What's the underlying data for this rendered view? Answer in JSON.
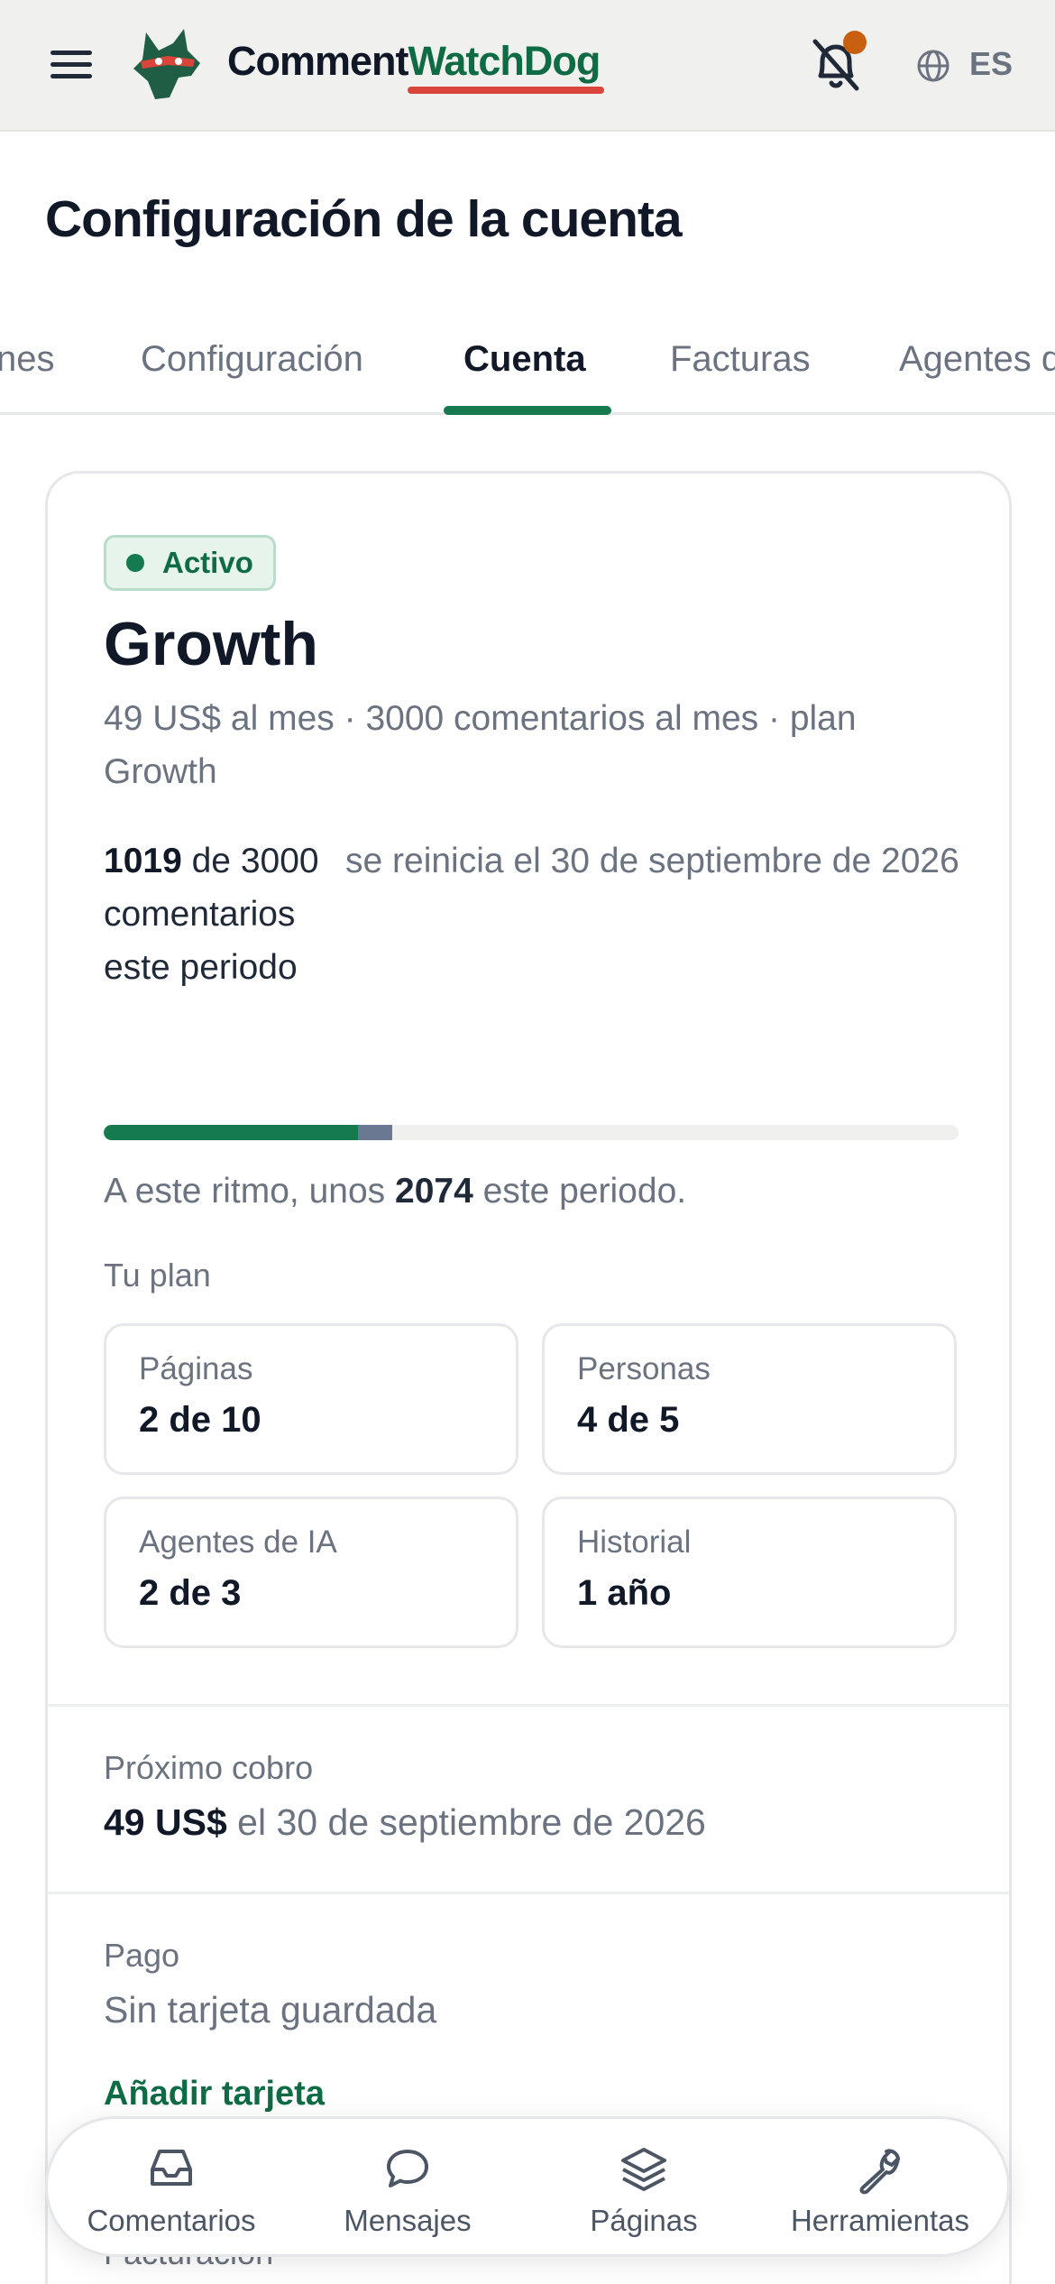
{
  "header": {
    "brand_part1": "Comment",
    "brand_part2": "WatchDog",
    "language": "ES",
    "colors": {
      "brand_green": "#0f6b43",
      "brand_red": "#d9453a",
      "notification_dot": "#c8600f"
    }
  },
  "page": {
    "title": "Configuración de la cuenta"
  },
  "tabs": [
    {
      "label": "nes"
    },
    {
      "label": "Configuración"
    },
    {
      "label": "Cuenta",
      "active": true
    },
    {
      "label": "Facturas"
    },
    {
      "label": "Agentes d"
    }
  ],
  "plan": {
    "status": "Activo",
    "name": "Growth",
    "description": "49 US$ al mes · 3000 comentarios al mes · plan Growth",
    "usage_count": "1019",
    "usage_rest": " de 3000 comentarios este periodo",
    "reset_text": "se reinicia el 30 de septiembre de 2026",
    "usage_fraction": 0.297,
    "projected_fraction": 0.04,
    "pace_prefix": "A este ritmo, unos ",
    "pace_value": "2074",
    "pace_suffix": " este periodo.",
    "your_plan_label": "Tu plan",
    "tiles": [
      {
        "label": "Páginas",
        "value": "2 de 10"
      },
      {
        "label": "Personas",
        "value": "4 de 5"
      },
      {
        "label": "Agentes de IA",
        "value": "2 de 3"
      },
      {
        "label": "Historial",
        "value": "1 año"
      }
    ]
  },
  "next_charge": {
    "label": "Próximo cobro",
    "amount": "49 US$",
    "date_text": " el 30 de septiembre de 2026"
  },
  "payment": {
    "label": "Pago",
    "value": "Sin tarjeta guardada",
    "add_card": "Añadir tarjeta"
  },
  "billing": {
    "label": "Facturación"
  },
  "bottom_nav": [
    {
      "label": "Comentarios",
      "icon": "inbox-icon"
    },
    {
      "label": "Mensajes",
      "icon": "chat-bubble-icon"
    },
    {
      "label": "Páginas",
      "icon": "layers-icon"
    },
    {
      "label": "Herramientas",
      "icon": "wrench-icon"
    }
  ]
}
